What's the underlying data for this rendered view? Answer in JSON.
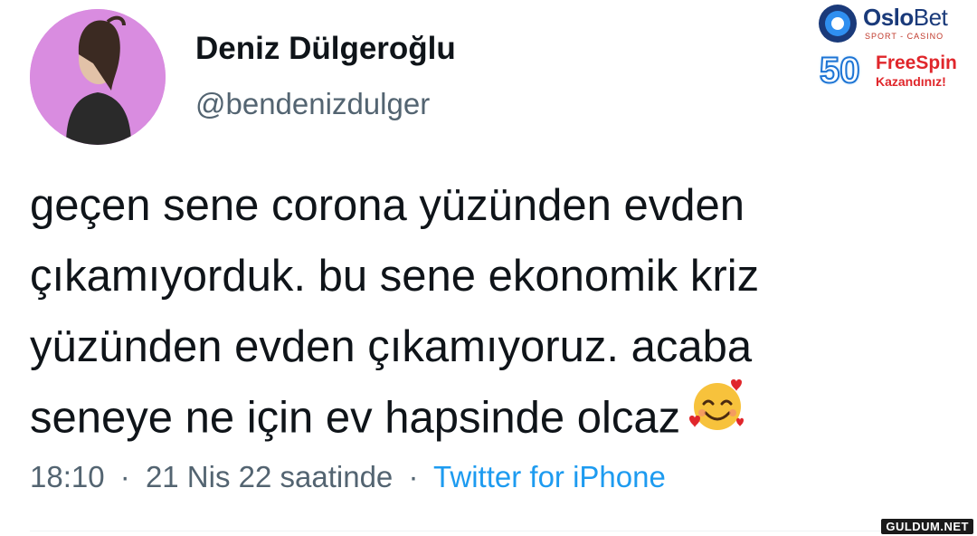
{
  "tweet": {
    "display_name": "Deniz Dülgeroğlu",
    "handle": "@bendenizdulger",
    "text_lines": [
      "geçen sene corona yüzünden evden",
      "çıkamıyorduk. bu sene ekonomik kriz",
      "yüzünden evden çıkamıyoruz. acaba",
      "seneye ne için ev hapsinde olcaz"
    ],
    "emoji_icon": "smiling-face-with-hearts-icon",
    "time": "18:10",
    "separator": "·",
    "date": "21 Nis 22 saatinde",
    "source": "Twitter for iPhone"
  },
  "ad": {
    "brand_bold": "Oslo",
    "brand_light": "Bet",
    "tagline": "SPORT - CASINO",
    "number": "50",
    "offer_line1": "FreeSpin",
    "offer_line2": "Kazandınız!"
  },
  "watermark": "GULDUM.NET",
  "colors": {
    "text_primary": "#0f1419",
    "text_secondary": "#536471",
    "link": "#1d9bf0",
    "avatar_bg": "#d98ce0",
    "ad_red": "#e0262b",
    "ad_blue": "#1a3a7a"
  }
}
